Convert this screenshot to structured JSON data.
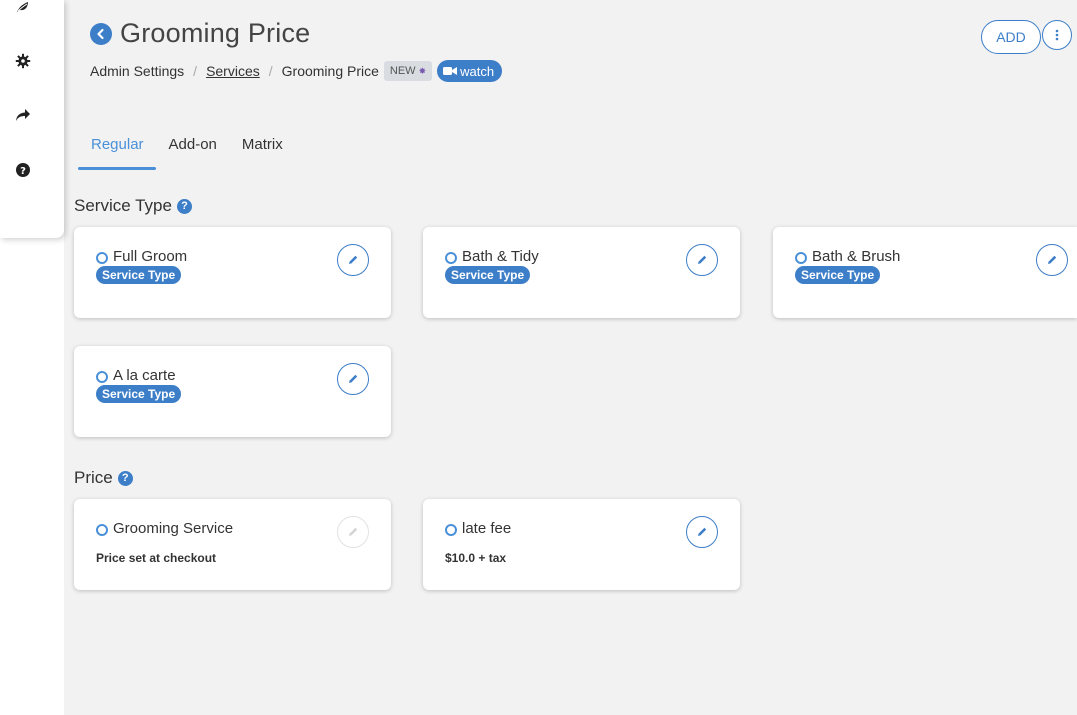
{
  "sidebar": {
    "icons": [
      "leaf-icon",
      "gear-icon",
      "share-icon",
      "question-circle-icon"
    ]
  },
  "header": {
    "title": "Grooming Price",
    "breadcrumb": {
      "root": "Admin Settings",
      "link": "Services",
      "current": "Grooming Price"
    },
    "new_badge": "NEW",
    "watch_label": "watch",
    "add_label": "ADD"
  },
  "tabs": [
    {
      "label": "Regular",
      "active": true
    },
    {
      "label": "Add-on",
      "active": false
    },
    {
      "label": "Matrix",
      "active": false
    }
  ],
  "service_type": {
    "title": "Service Type",
    "cards": [
      {
        "name": "Full Groom",
        "badge": "Service Type"
      },
      {
        "name": "Bath & Tidy",
        "badge": "Service Type"
      },
      {
        "name": "Bath & Brush",
        "badge": "Service Type"
      },
      {
        "name": "A la carte",
        "badge": "Service Type"
      }
    ]
  },
  "price": {
    "title": "Price",
    "cards": [
      {
        "name": "Grooming Service",
        "detail": "Price set at checkout",
        "edit_enabled": false
      },
      {
        "name": "late fee",
        "detail": "$10.0 + tax",
        "edit_enabled": true
      }
    ]
  },
  "colors": {
    "accent": "#3d7ec8",
    "tab_active": "#4a90d9",
    "background": "#f2f2f2"
  }
}
